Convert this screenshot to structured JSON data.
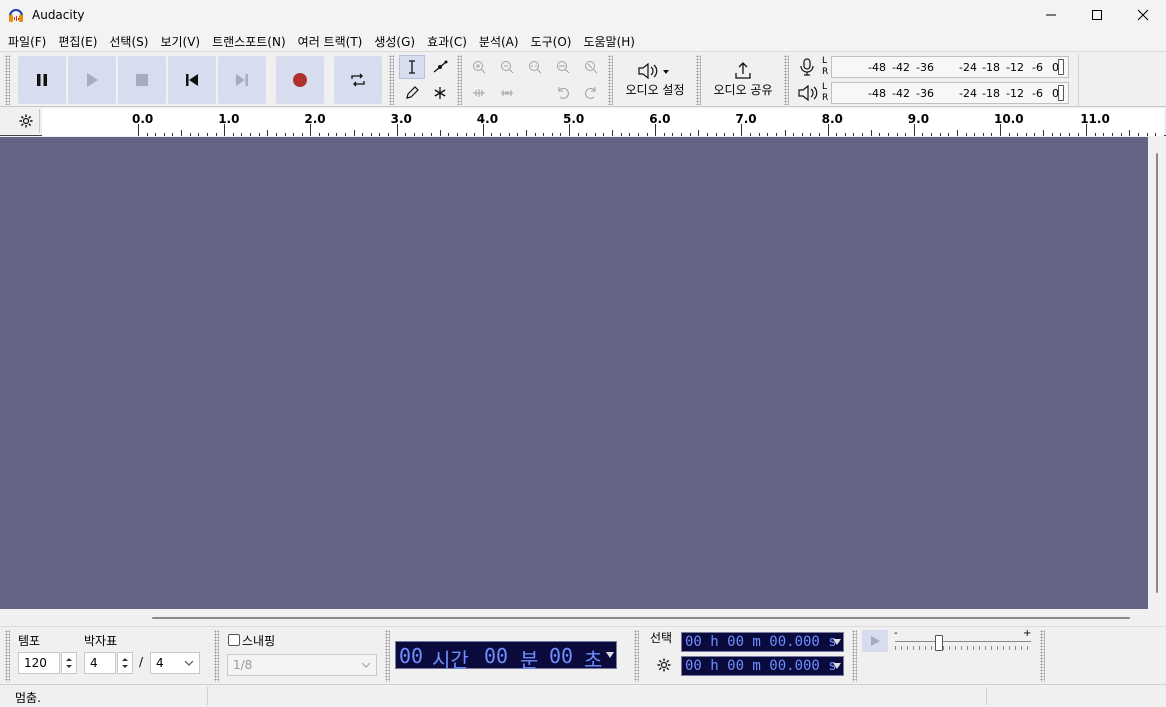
{
  "window": {
    "title": "Audacity"
  },
  "menu": [
    "파일(F)",
    "편집(E)",
    "선택(S)",
    "보기(V)",
    "트랜스포트(N)",
    "여러 트랙(T)",
    "생성(G)",
    "효과(C)",
    "분석(A)",
    "도구(O)",
    "도움말(H)"
  ],
  "toolbar": {
    "audio_setup_label": "오디오 설정",
    "share_audio_label": "오디오 공유"
  },
  "meters": {
    "lr_l": "L",
    "lr_r": "R",
    "scale": [
      "-48",
      "-42",
      "-36",
      "-24",
      "-18",
      "-12",
      "-6",
      "0"
    ]
  },
  "ruler": {
    "labels": [
      "0.0",
      "1.0",
      "2.0",
      "3.0",
      "4.0",
      "5.0",
      "6.0",
      "7.0",
      "8.0",
      "9.0",
      "10.0",
      "11.0"
    ]
  },
  "bottom": {
    "tempo_label": "템포",
    "tempo_value": "120",
    "time_sig_label": "박자표",
    "time_sig_top": "4",
    "time_sig_slash": "/",
    "time_sig_bottom": "4",
    "snap_label": "스내핑",
    "snap_value": "1/8",
    "time_display": [
      "00",
      "시간",
      "00",
      "분",
      "00",
      "초"
    ],
    "selection_label": "선택",
    "selection_start": "00 h 00 m 00.000 s",
    "selection_end": "00 h 00 m 00.000 s",
    "speed_minus": "-",
    "speed_plus": "+"
  },
  "status": {
    "text": "멈춤."
  },
  "colors": {
    "track_bg": "#646484",
    "button_bg": "#d8dcef",
    "record": "#b03030",
    "time_text": "#6f8fff"
  }
}
